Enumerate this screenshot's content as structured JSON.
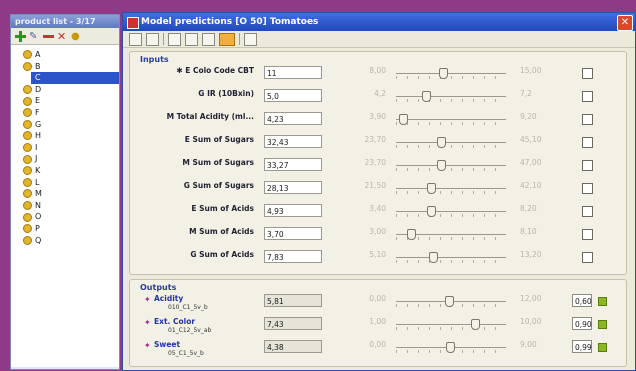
{
  "product_list": {
    "title": "product list - 3/17",
    "items": [
      {
        "label": "A",
        "selected": false
      },
      {
        "label": "B",
        "selected": false
      },
      {
        "label": "C",
        "selected": true
      },
      {
        "label": "D",
        "selected": false
      },
      {
        "label": "E",
        "selected": false
      },
      {
        "label": "F",
        "selected": false
      },
      {
        "label": "G",
        "selected": false
      },
      {
        "label": "H",
        "selected": false
      },
      {
        "label": "I",
        "selected": false
      },
      {
        "label": "J",
        "selected": false
      },
      {
        "label": "K",
        "selected": false
      },
      {
        "label": "L",
        "selected": false
      },
      {
        "label": "M",
        "selected": false
      },
      {
        "label": "N",
        "selected": false
      },
      {
        "label": "O",
        "selected": false
      },
      {
        "label": "P",
        "selected": false
      },
      {
        "label": "Q",
        "selected": false
      }
    ]
  },
  "dialog": {
    "title": "Model predictions   [O 50] Tomatoes",
    "close_glyph": "✕"
  },
  "inputs": {
    "title": "Inputs",
    "rows": [
      {
        "label": "✱ E  Colo Code CBT",
        "value": "11",
        "min": "8,00",
        "max": "15,00",
        "fraction": 0.43
      },
      {
        "label": "G IR (10Bxin)",
        "value": "5,0",
        "min": "4,2",
        "max": "7,2",
        "fraction": 0.27
      },
      {
        "label": "M Total Acidity (ml...",
        "value": "4,23",
        "min": "3,90",
        "max": "9,20",
        "fraction": 0.06
      },
      {
        "label": "E Sum of Sugars",
        "value": "32,43",
        "min": "23,70",
        "max": "45,10",
        "fraction": 0.41
      },
      {
        "label": "M Sum of Sugars",
        "value": "33,27",
        "min": "23,70",
        "max": "47,00",
        "fraction": 0.41
      },
      {
        "label": "G Sum of Sugars",
        "value": "28,13",
        "min": "21,50",
        "max": "42,10",
        "fraction": 0.32
      },
      {
        "label": "E Sum of Acids",
        "value": "4,93",
        "min": "3,40",
        "max": "8,20",
        "fraction": 0.32
      },
      {
        "label": "M Sum of Acids",
        "value": "3,70",
        "min": "3,00",
        "max": "8,10",
        "fraction": 0.14
      },
      {
        "label": "G Sum of Acids",
        "value": "7,83",
        "min": "5,10",
        "max": "13,20",
        "fraction": 0.34
      }
    ]
  },
  "outputs": {
    "title": "Outputs",
    "rows": [
      {
        "label": "Acidity",
        "sub": "010_C1_5v_b",
        "value": "5,81",
        "min": "0,00",
        "max": "12,00",
        "fraction": 0.48,
        "score": "0,60"
      },
      {
        "label": "Ext. Color",
        "sub": "01_C12_5v_ab",
        "value": "7,43",
        "min": "1,00",
        "max": "10,00",
        "fraction": 0.72,
        "score": "0,90"
      },
      {
        "label": "Sweet",
        "sub": "05_C1_5v_b",
        "value": "4,38",
        "min": "0,00",
        "max": "9,00",
        "fraction": 0.49,
        "score": "0,99"
      }
    ]
  },
  "colors": {
    "titlebar": "#2d55c8",
    "selection": "#2b55c8",
    "background": "#8f3a86"
  }
}
